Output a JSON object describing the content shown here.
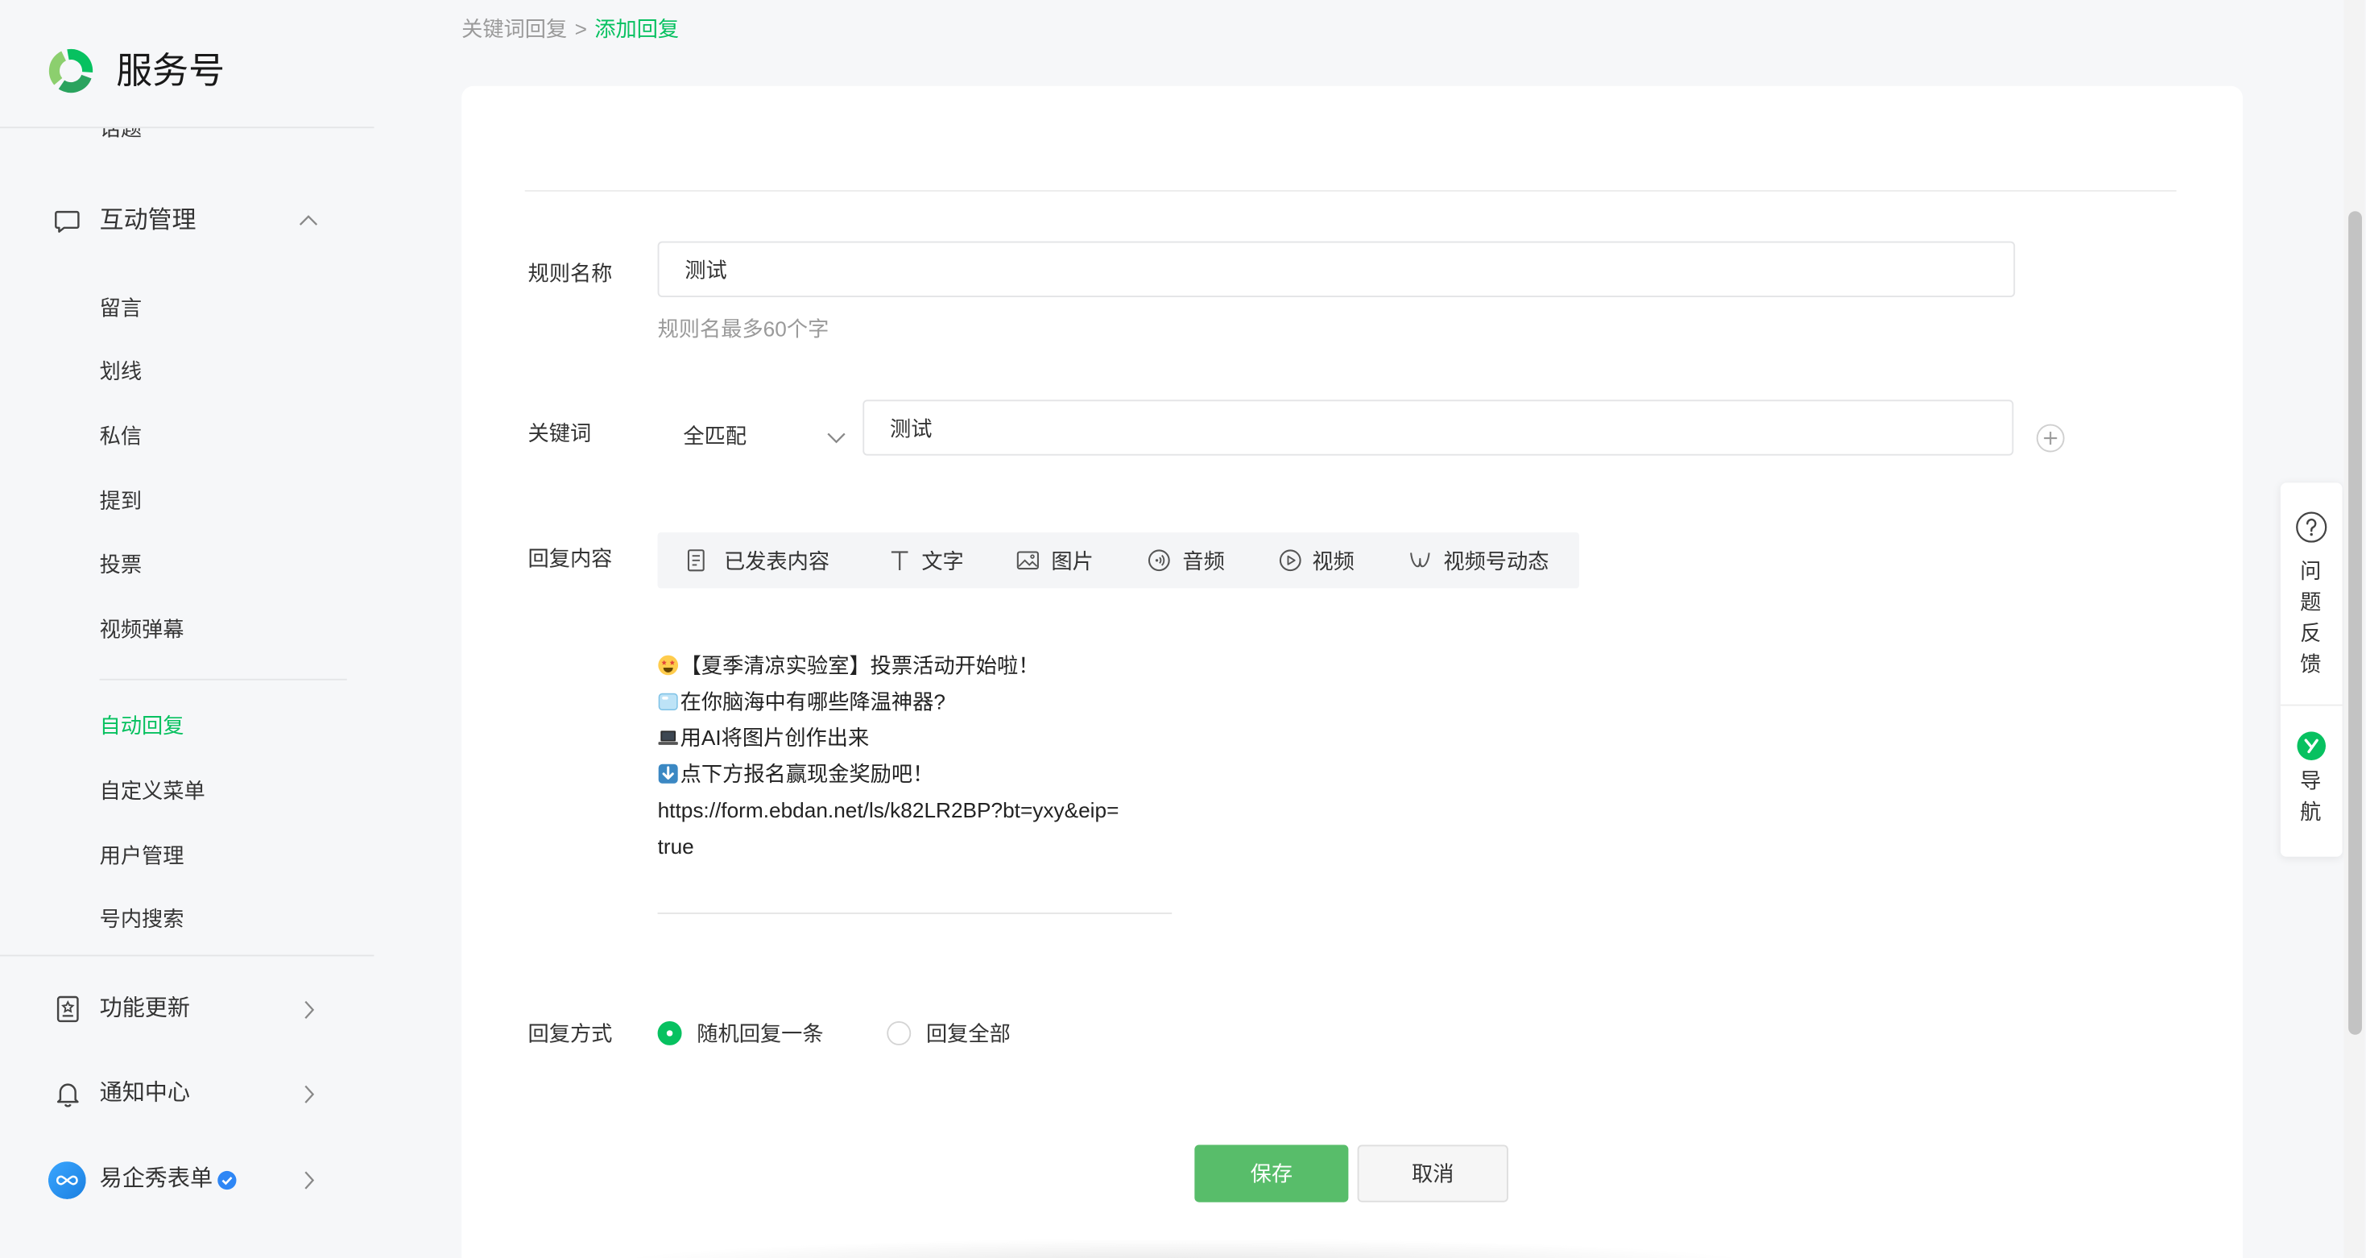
{
  "app": {
    "name": "服务号",
    "logo_icon": "service-account-logo-icon"
  },
  "colors": {
    "accent": "#07c160",
    "primary_button": "#58bd6a",
    "page_background": "#f6f7f9"
  },
  "breadcrumb": {
    "parent": "关键词回复",
    "separator": ">",
    "current": "添加回复"
  },
  "sidebar": {
    "clipped_item": "话题",
    "interaction_group": {
      "label": "互动管理",
      "icon": "message-icon",
      "expanded": true,
      "items": [
        "留言",
        "划线",
        "私信",
        "提到",
        "投票",
        "视频弹幕"
      ]
    },
    "service_items": [
      "自动回复",
      "自定义菜单",
      "用户管理",
      "号内搜索"
    ],
    "active_service_item": 0,
    "bottom_items": [
      {
        "label": "功能更新",
        "icon": "feature-update-icon"
      },
      {
        "label": "通知中心",
        "icon": "bell-icon"
      }
    ],
    "account": {
      "name": "易企秀表单",
      "avatar_icon": "account-avatar-icon",
      "verified": true
    }
  },
  "form": {
    "rule_name": {
      "label": "规则名称",
      "value": "测试",
      "hint": "规则名最多60个字"
    },
    "keyword": {
      "label": "关键词",
      "match_type": "全匹配",
      "value": "测试",
      "add_icon": "plus-circle-icon"
    },
    "reply_content": {
      "label": "回复内容",
      "toolbar": [
        {
          "label": "已发表内容",
          "icon": "article-icon"
        },
        {
          "label": "文字",
          "icon": "text-icon"
        },
        {
          "label": "图片",
          "icon": "image-icon"
        },
        {
          "label": "音频",
          "icon": "audio-icon"
        },
        {
          "label": "视频",
          "icon": "video-icon"
        },
        {
          "label": "视频号动态",
          "icon": "channels-icon"
        }
      ],
      "lines": [
        {
          "emoji": "star-struck-emoji",
          "text": "【夏季清凉实验室】投票活动开始啦！"
        },
        {
          "emoji": "ice-cube-emoji",
          "text": "在你脑海中有哪些降温神器?"
        },
        {
          "emoji": "laptop-emoji",
          "text": "用AI将图片创作出来"
        },
        {
          "emoji": "down-arrow-emoji",
          "text": "点下方报名赢现金奖励吧！"
        },
        {
          "text": "https://form.ebdan.net/ls/k82LR2BP?bt=yxy&eip="
        },
        {
          "text": "true"
        }
      ]
    },
    "reply_mode": {
      "label": "回复方式",
      "options": [
        {
          "label": "随机回复一条",
          "selected": true
        },
        {
          "label": "回复全部",
          "selected": false
        }
      ]
    },
    "buttons": {
      "save": "保存",
      "cancel": "取消"
    }
  },
  "side_tools": {
    "feedback": {
      "label": "问题反馈",
      "icon": "question-circle-icon"
    },
    "guide": {
      "label": "导航",
      "icon": "guide-icon"
    }
  }
}
